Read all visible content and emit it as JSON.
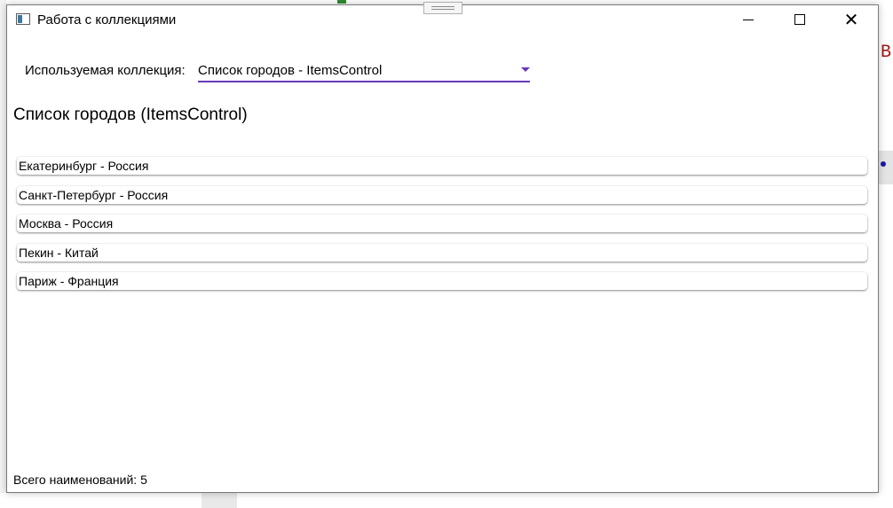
{
  "window": {
    "title": "Работа с коллекциями",
    "min_label": "Свернуть",
    "max_label": "Развернуть",
    "close_glyph": "✕"
  },
  "collection": {
    "label": "Используемая коллекция:",
    "selected": "Список городов - ItemsControl"
  },
  "section_title": "Список городов (ItemsControl)",
  "items": [
    "Екатеринбург - Россия",
    "Санкт-Петербург - Россия",
    "Москва - Россия",
    "Пекин - Китай",
    "Париж - Франция"
  ],
  "footer": {
    "total": "Всего наименований: 5"
  },
  "background": {
    "right_char": "В"
  },
  "colors": {
    "accent": "#673ab7"
  }
}
